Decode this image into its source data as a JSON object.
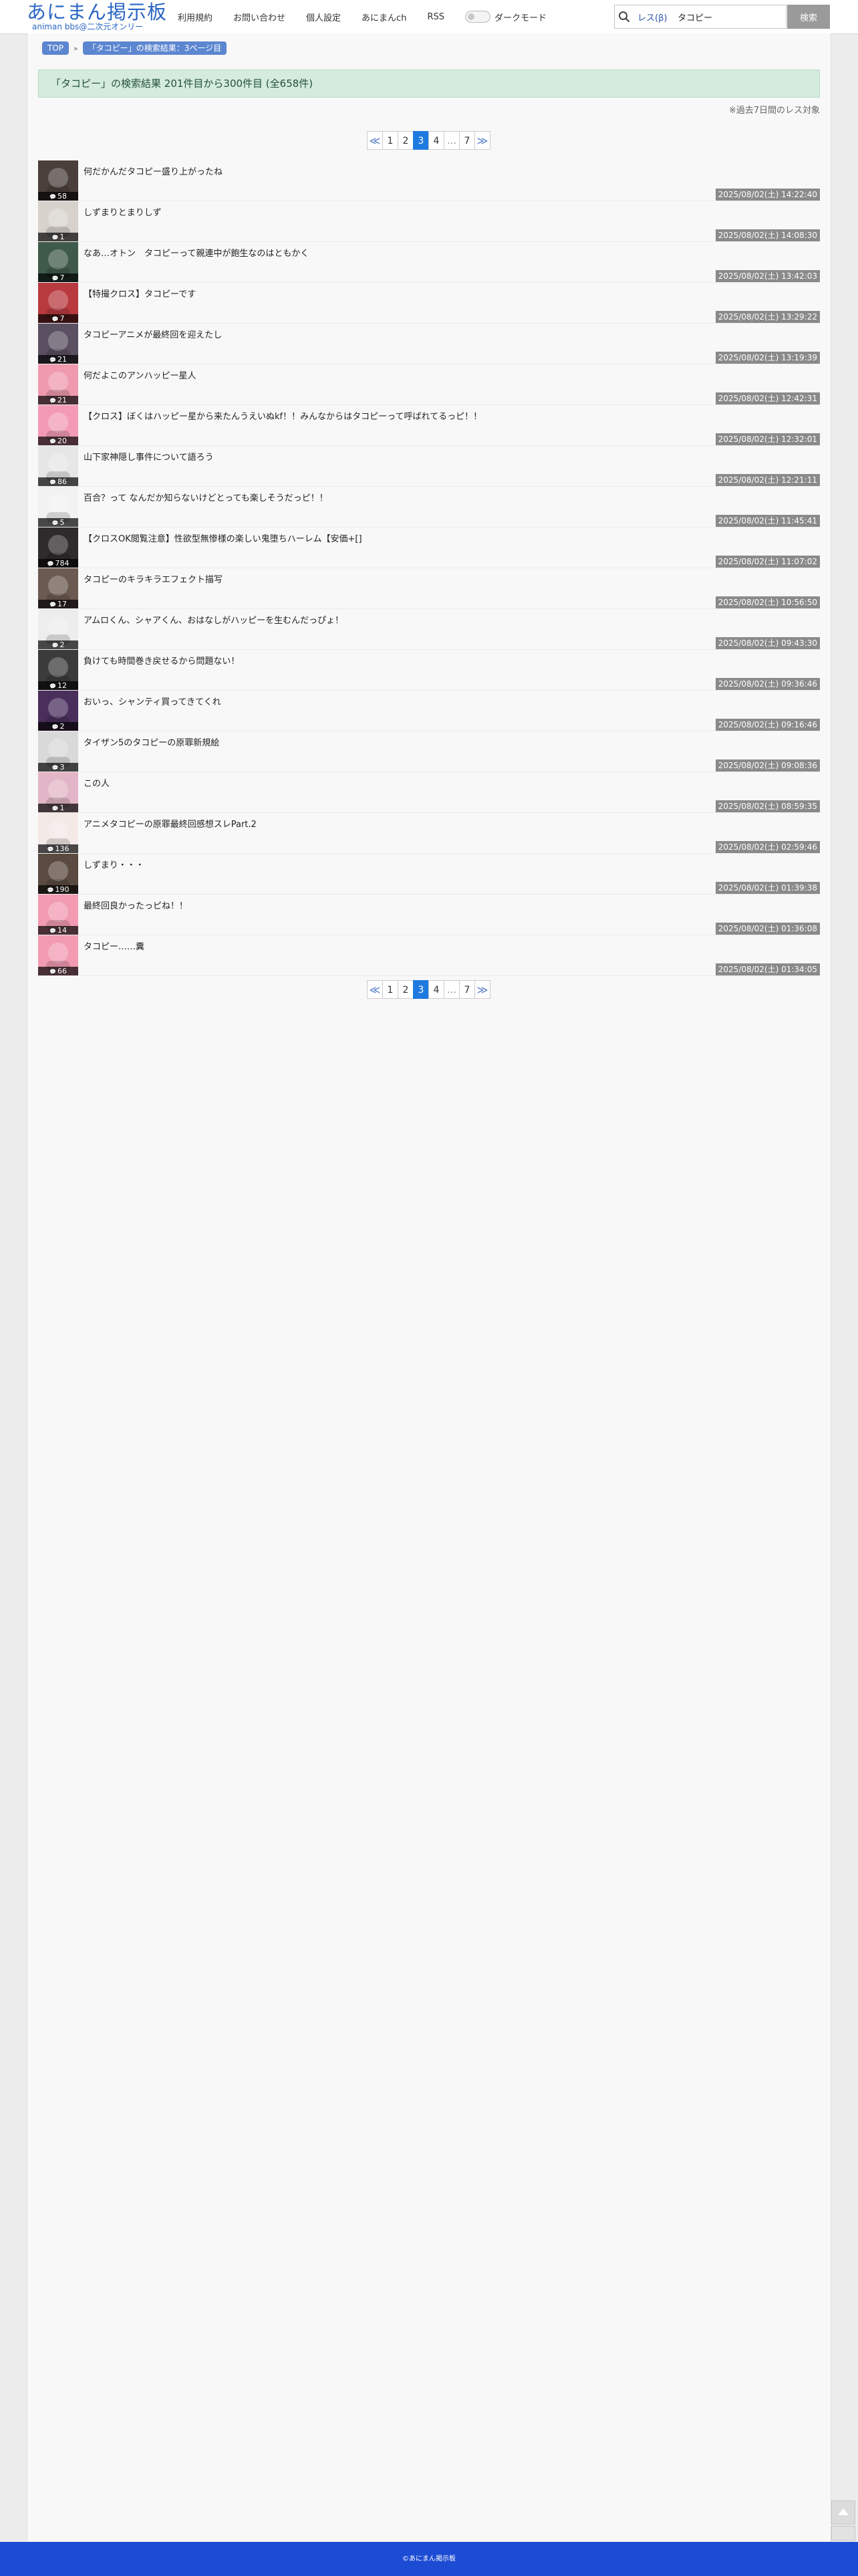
{
  "header": {
    "logo_title": "あにまん掲示板",
    "logo_subtitle": "animan bbs@二次元オンリー",
    "nav": [
      "利用規約",
      "お問い合わせ",
      "個人設定",
      "あにまんch",
      "RSS"
    ],
    "dark_mode_label": "ダークモード",
    "search_scope": "レス(β)",
    "search_value": "タコピー",
    "search_button": "検索"
  },
  "breadcrumb": {
    "top": "TOP",
    "separator": "»",
    "current": "「タコピー」の検索結果：3ページ目"
  },
  "result_banner": "「タコピー」の検索結果 201件目から300件目 (全658件)",
  "note": "※過去7日間のレス対象",
  "pagination": {
    "prev": "≪",
    "pages": [
      "1",
      "2",
      "3",
      "4",
      "…",
      "7"
    ],
    "current": "3",
    "next": "≫"
  },
  "threads": [
    {
      "title": "何だかんだタコピー盛り上がったね",
      "count": "58",
      "date": "2025/08/02(土) 14:22:40",
      "thumb_color": "#4a3f3a"
    },
    {
      "title": "しずまりとまりしず",
      "count": "1",
      "date": "2025/08/02(土) 14:08:30",
      "thumb_color": "#d7d2cc"
    },
    {
      "title": "なあ…オトン　タコピーって親連中が飽生なのはともかく",
      "count": "7",
      "date": "2025/08/02(土) 13:42:03",
      "thumb_color": "#3f5a4a"
    },
    {
      "title": "【特撮クロス】タコピーです",
      "count": "7",
      "date": "2025/08/02(土) 13:29:22",
      "thumb_color": "#b83a3f"
    },
    {
      "title": "タコピーアニメが最終回を迎えたし",
      "count": "21",
      "date": "2025/08/02(土) 13:19:39",
      "thumb_color": "#5b4f62"
    },
    {
      "title": "何だよこのアンハッピー星人",
      "count": "21",
      "date": "2025/08/02(土) 12:42:31",
      "thumb_color": "#ef9aae"
    },
    {
      "title": "【クロス】ぼくはハッピー星から来たんうえいぬkf！！みんなからはタコピーって呼ばれてるっピ！！",
      "count": "20",
      "date": "2025/08/02(土) 12:32:01",
      "thumb_color": "#f39bb4"
    },
    {
      "title": "山下家神隠し事件について語ろう",
      "count": "86",
      "date": "2025/08/02(土) 12:21:11",
      "thumb_color": "#e6e6e6"
    },
    {
      "title": "百合？って なんだか知らないけどとっても楽しそうだっピ！！",
      "count": "5",
      "date": "2025/08/02(土) 11:45:41",
      "thumb_color": "#f2f2f2"
    },
    {
      "title": "【クロスOK閲覧注意】性欲型無惨様の楽しい鬼堕ちハーレム【安価+[]",
      "count": "784",
      "date": "2025/08/02(土) 11:07:02",
      "thumb_color": "#2f2a2c"
    },
    {
      "title": "タコピーのキラキラエフェクト描写",
      "count": "17",
      "date": "2025/08/02(土) 10:56:50",
      "thumb_color": "#6b5a50"
    },
    {
      "title": "アムロくん、シャアくん、おはなしがハッピーを生むんだっぴょ！",
      "count": "2",
      "date": "2025/08/02(土) 09:43:30",
      "thumb_color": "#ededed"
    },
    {
      "title": "負けても時間巻き戻せるから問題ない！",
      "count": "12",
      "date": "2025/08/02(土) 09:36:46",
      "thumb_color": "#3b3b3b"
    },
    {
      "title": "おいっ、シャンティ買ってきてくれ",
      "count": "2",
      "date": "2025/08/02(土) 09:16:46",
      "thumb_color": "#4a2f5c"
    },
    {
      "title": "タイザン5のタコピーの原罪新規絵",
      "count": "3",
      "date": "2025/08/02(土) 09:08:36",
      "thumb_color": "#d9d9d9"
    },
    {
      "title": "この人",
      "count": "1",
      "date": "2025/08/02(土) 08:59:35",
      "thumb_color": "#e2b6c6"
    },
    {
      "title": "アニメタコピーの原罪最終回感想スレPart.2",
      "count": "136",
      "date": "2025/08/02(土) 02:59:46",
      "thumb_color": "#f3e9e6"
    },
    {
      "title": "しずまり・・・",
      "count": "190",
      "date": "2025/08/02(土) 01:39:38",
      "thumb_color": "#5a4a3f"
    },
    {
      "title": "最終回良かったっピね！！",
      "count": "14",
      "date": "2025/08/02(土) 01:36:08",
      "thumb_color": "#f29bb2"
    },
    {
      "title": "タコピー……糞",
      "count": "66",
      "date": "2025/08/02(土) 01:34:05",
      "thumb_color": "#f29bb2"
    }
  ],
  "footer": "©あにまん掲示板"
}
